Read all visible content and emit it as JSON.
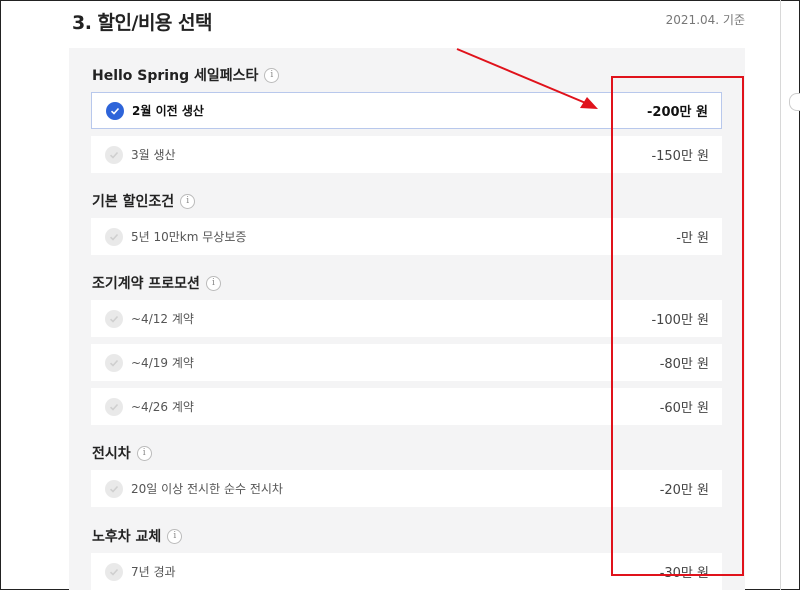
{
  "header": {
    "title": "3. 할인/비용 선택",
    "date": "2021.04. 기준"
  },
  "sections": [
    {
      "title": "Hello Spring 세일페스타",
      "options": [
        {
          "label": "2월 이전 생산",
          "value": "-200만 원",
          "selected": true
        },
        {
          "label": "3월 생산",
          "value": "-150만 원",
          "selected": false
        }
      ]
    },
    {
      "title": "기본 할인조건",
      "options": [
        {
          "label": "5년 10만km 무상보증",
          "value": "-만 원",
          "selected": false
        }
      ]
    },
    {
      "title": "조기계약 프로모션",
      "options": [
        {
          "label": "~4/12 계약",
          "value": "-100만 원",
          "selected": false
        },
        {
          "label": "~4/19 계약",
          "value": "-80만 원",
          "selected": false
        },
        {
          "label": "~4/26 계약",
          "value": "-60만 원",
          "selected": false
        }
      ]
    },
    {
      "title": "전시차",
      "options": [
        {
          "label": "20일 이상 전시한 순수 전시차",
          "value": "-20만 원",
          "selected": false
        }
      ]
    },
    {
      "title": "노후차 교체",
      "options": [
        {
          "label": "7년 경과",
          "value": "-30만 원",
          "selected": false
        }
      ]
    }
  ],
  "info_icon_glyph": "i",
  "annotation_color": "#e0121b",
  "accent_color": "#2e64d9"
}
